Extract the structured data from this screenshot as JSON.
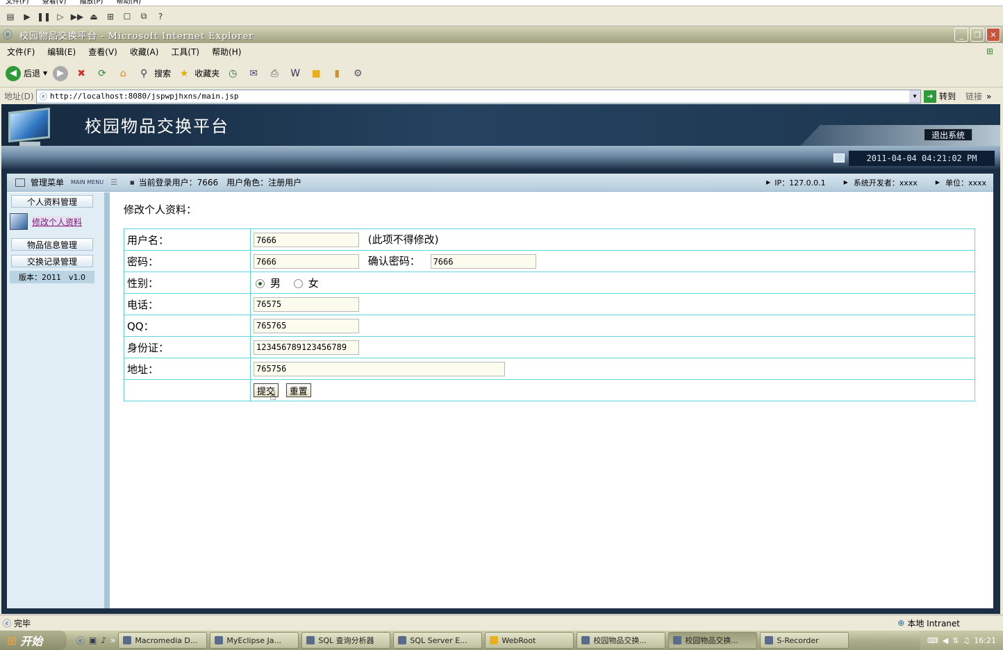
{
  "recorder": {
    "menu": [
      "文件(F)",
      "查看(V)",
      "播放(P)",
      "帮助(H)"
    ]
  },
  "window": {
    "title": "校园物品交换平台 - Microsoft Internet Explorer"
  },
  "ie_menu": [
    "文件(F)",
    "编辑(E)",
    "查看(V)",
    "收藏(A)",
    "工具(T)",
    "帮助(H)"
  ],
  "ie_toolbar": {
    "back": "后退",
    "search": "搜索",
    "favorites": "收藏夹"
  },
  "address": {
    "label": "地址(D)",
    "url": "http://localhost:8080/jspwpjhxns/main.jsp",
    "go": "转到",
    "links": "链接"
  },
  "site": {
    "title": "校园物品交换平台",
    "logout": "退出系统",
    "datetime": "2011-04-04 04:21:02 PM"
  },
  "topbar": {
    "menu_label": "管理菜单",
    "menu_sub": "MAIN MENU",
    "user_info": "当前登录用户：7666　用户角色：注册用户",
    "ip": "IP：127.0.0.1",
    "developer": "系统开发者：xxxx",
    "unit": "单位：xxxx"
  },
  "sidebar": {
    "items": [
      {
        "label": "个人资料管理"
      },
      {
        "label": "修改个人资料"
      },
      {
        "label": "物品信息管理"
      },
      {
        "label": "交换记录管理"
      }
    ],
    "version": "版本：2011　v1.0"
  },
  "form": {
    "title": "修改个人资料：",
    "username_label": "用户名：",
    "username": "7666",
    "username_note": "(此项不得修改)",
    "password_label": "密码：",
    "password": "7666",
    "confirm_label": "确认密码：",
    "confirm": "7666",
    "gender_label": "性别：",
    "gender_male": "男",
    "gender_female": "女",
    "gender_selected": "男",
    "phone_label": "电话：",
    "phone": "76575",
    "qq_label": "QQ：",
    "qq": "765765",
    "idcard_label": "身份证：",
    "idcard": "123456789123456789",
    "address_label": "地址：",
    "address": "765756",
    "submit": "提交",
    "reset": "重置"
  },
  "status": {
    "text": "完毕",
    "zone": "本地 Intranet"
  },
  "taskbar": {
    "start": "开始",
    "tasks": [
      {
        "label": "Macromedia D..."
      },
      {
        "label": "MyEclipse Ja..."
      },
      {
        "label": "SQL 查询分析器"
      },
      {
        "label": "SQL Server E..."
      },
      {
        "label": "WebRoot"
      },
      {
        "label": "校园物品交换..."
      },
      {
        "label": "校园物品交换..."
      },
      {
        "label": "S-Recorder"
      }
    ],
    "clock": "16:21"
  },
  "colors": {
    "banner": "#1d364f",
    "table_border": "#5fd4de",
    "sidebar_bg": "#e1edf4"
  }
}
